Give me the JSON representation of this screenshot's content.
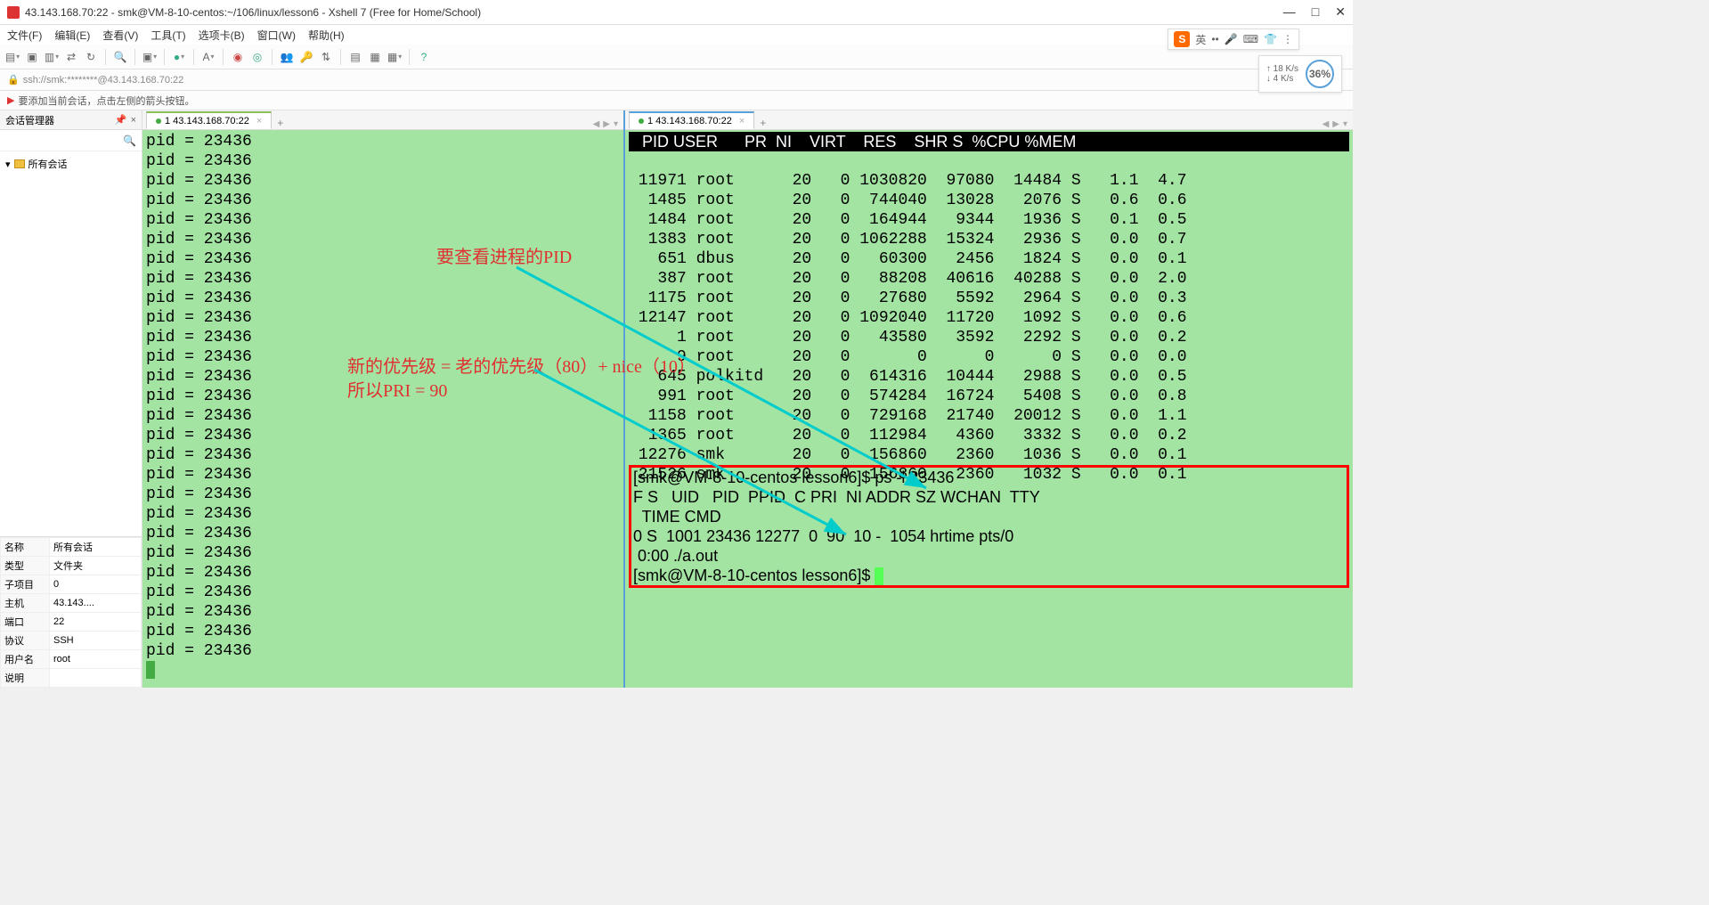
{
  "window": {
    "title": "43.143.168.70:22 - smk@VM-8-10-centos:~/106/linux/lesson6 - Xshell 7 (Free for Home/School)"
  },
  "menu": {
    "file": "文件(F)",
    "edit": "编辑(E)",
    "view": "查看(V)",
    "tools": "工具(T)",
    "cards": "选项卡(B)",
    "window": "窗口(W)",
    "help": "帮助(H)"
  },
  "addr": "ssh://smk:********@43.143.168.70:22",
  "hint": "要添加当前会话，点击左侧的箭头按钮。",
  "sidebar": {
    "title": "会话管理器",
    "all_sessions": "所有会话",
    "props": [
      [
        "名称",
        "所有会话"
      ],
      [
        "类型",
        "文件夹"
      ],
      [
        "子项目",
        "0"
      ],
      [
        "主机",
        "43.143...."
      ],
      [
        "端口",
        "22"
      ],
      [
        "协议",
        "SSH"
      ],
      [
        "用户名",
        "root"
      ],
      [
        "说明",
        ""
      ]
    ]
  },
  "tab1": {
    "label": "1 43.143.168.70:22"
  },
  "tab2": {
    "label": "1 43.143.168.70:22"
  },
  "left_lines": [
    "pid = 23436",
    "pid = 23436",
    "pid = 23436",
    "pid = 23436",
    "pid = 23436",
    "pid = 23436",
    "pid = 23436",
    "pid = 23436",
    "pid = 23436",
    "pid = 23436",
    "pid = 23436",
    "pid = 23436",
    "pid = 23436",
    "pid = 23436",
    "pid = 23436",
    "pid = 23436",
    "pid = 23436",
    "pid = 23436",
    "pid = 23436",
    "pid = 23436",
    "pid = 23436",
    "pid = 23436",
    "pid = 23436",
    "pid = 23436",
    "pid = 23436",
    "pid = 23436",
    "pid = 23436"
  ],
  "top_header": "   PID USER      PR  NI    VIRT    RES    SHR S  %CPU %MEM",
  "top_rows": [
    " 11971 root      20   0 1030820  97080  14484 S   1.1  4.7",
    "  1485 root      20   0  744040  13028   2076 S   0.6  0.6",
    "  1484 root      20   0  164944   9344   1936 S   0.1  0.5",
    "  1383 root      20   0 1062288  15324   2936 S   0.0  0.7",
    "   651 dbus      20   0   60300   2456   1824 S   0.0  0.1",
    "   387 root      20   0   88208  40616  40288 S   0.0  2.0",
    "  1175 root      20   0   27680   5592   2964 S   0.0  0.3",
    " 12147 root      20   0 1092040  11720   1092 S   0.0  0.6",
    "     1 root      20   0   43580   3592   2292 S   0.0  0.2",
    "     9 root      20   0       0      0      0 S   0.0  0.0",
    "   645 polkitd   20   0  614316  10444   2988 S   0.0  0.5",
    "   991 root      20   0  574284  16724   5408 S   0.0  0.8",
    "  1158 root      20   0  729168  21740  20012 S   0.0  1.1",
    "  1365 root      20   0  112984   4360   3332 S   0.0  0.2",
    " 12276 smk       20   0  156860   2360   1036 S   0.0  0.1",
    " 21526 smk       20   0  156860   2360   1032 S   0.0  0.1"
  ],
  "ps_block": [
    "[smk@VM-8-10-centos lesson6]$ ps -l 23436",
    "F S   UID   PID  PPID  C PRI  NI ADDR SZ WCHAN  TTY",
    "  TIME CMD",
    "0 S  1001 23436 12277  0  90  10 -  1054 hrtime pts/0",
    " 0:00 ./a.out",
    "[smk@VM-8-10-centos lesson6]$ "
  ],
  "annotations": {
    "a1": "要查看进程的PID",
    "a2": "新的优先级 = 老的优先级（80）+ nice（10）",
    "a3": "所以PRI = 90"
  },
  "ime": {
    "lang": "英",
    "badge": "S"
  },
  "net": {
    "up": "↑ 18  K/s",
    "down": "↓ 4   K/s",
    "pct": "36%"
  }
}
